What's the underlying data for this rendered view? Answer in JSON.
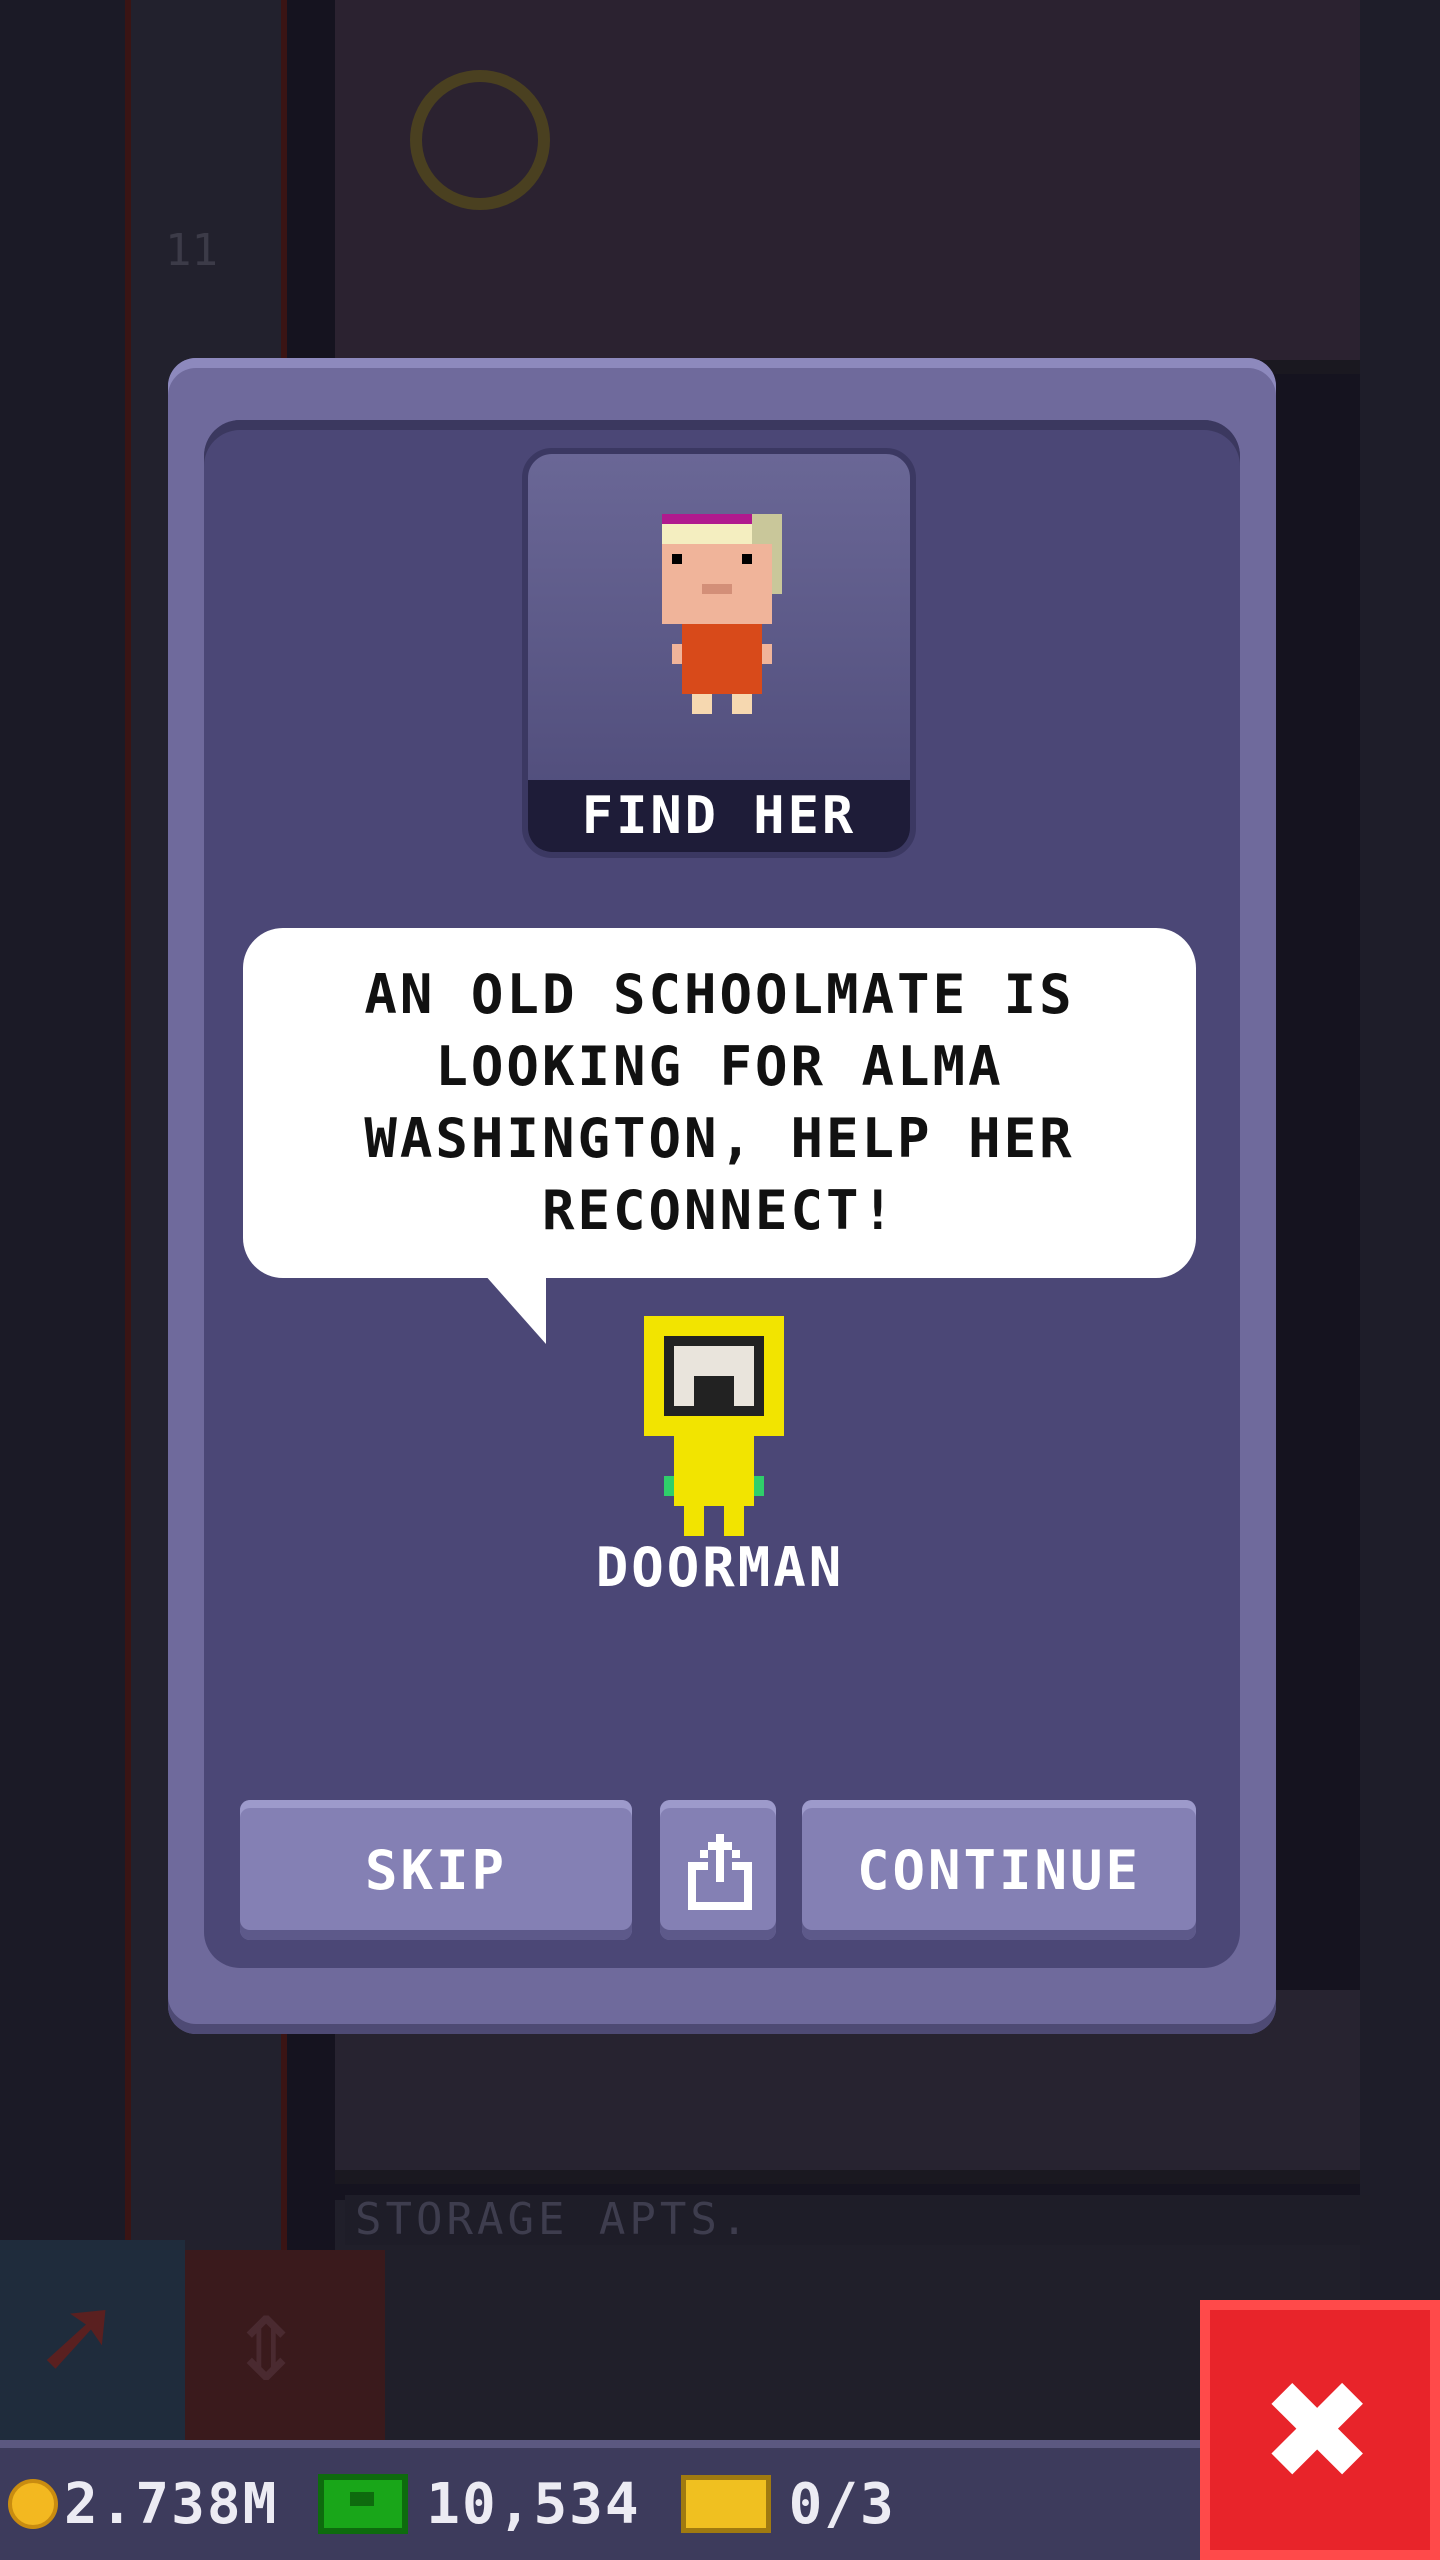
{
  "background": {
    "floor_number": "11",
    "floor_label": "STORAGE APTS."
  },
  "status_bar": {
    "coins": "2.738M",
    "bux": "10,534",
    "tickets": "0/3"
  },
  "modal": {
    "mission_title": "FIND HER",
    "message": "AN OLD SCHOOLMATE IS LOOKING FOR ALMA WASHINGTON, HELP HER RECONNECT!",
    "speaker_name": "DOORMAN",
    "buttons": {
      "skip": "SKIP",
      "continue": "CONTINUE"
    }
  },
  "icons": {
    "coin": "coin-icon",
    "bux": "bux-icon",
    "ticket": "ticket-icon",
    "share": "share-icon",
    "close": "close-icon"
  },
  "colors": {
    "modal_frame": "#6f6a9c",
    "modal_inner": "#4b4776",
    "button": "#8480b4",
    "close_button": "#e8242a"
  }
}
